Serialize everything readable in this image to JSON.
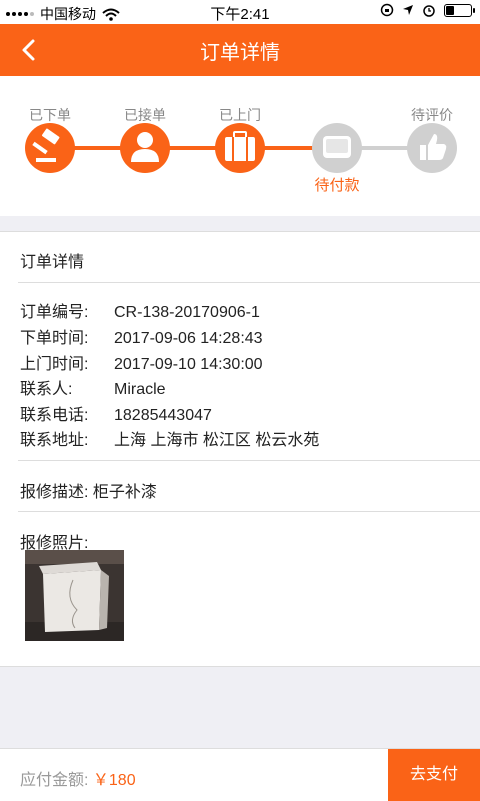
{
  "status_bar": {
    "carrier": "中国移动",
    "time": "下午2:41"
  },
  "nav": {
    "title": "订单详情",
    "back_icon": "chevron-left-icon"
  },
  "progress": {
    "steps": [
      {
        "label": "已下单",
        "icon": "gavel-icon",
        "done": true
      },
      {
        "label": "已接单",
        "icon": "user-icon",
        "done": true
      },
      {
        "label": "已上门",
        "icon": "toolbox-icon",
        "done": true
      },
      {
        "label": "待付款",
        "icon": "wallet-icon",
        "done": false,
        "current": true
      },
      {
        "label": "待评价",
        "icon": "thumbs-up-icon",
        "done": false
      }
    ],
    "active_color": "#fa6317",
    "inactive_color": "#d0d0d0"
  },
  "details": {
    "title": "订单详情",
    "rows": [
      {
        "key": "订单编号:",
        "value": "CR-138-20170906-1"
      },
      {
        "key": "下单时间:",
        "value": "2017-09-06 14:28:43"
      },
      {
        "key": "上门时间:",
        "value": "2017-09-10 14:30:00"
      },
      {
        "key": "联系人:",
        "value": "Miracle"
      },
      {
        "key": "联系电话:",
        "value": "18285443047"
      },
      {
        "key": "联系地址:",
        "value": "上海 上海市 松江区 松云水苑"
      }
    ],
    "description_label": "报修描述:",
    "description": "柜子补漆",
    "photo_label": "报修照片:"
  },
  "footer": {
    "amount_label": "应付金额:",
    "amount": "￥180",
    "pay_button": "去支付"
  }
}
